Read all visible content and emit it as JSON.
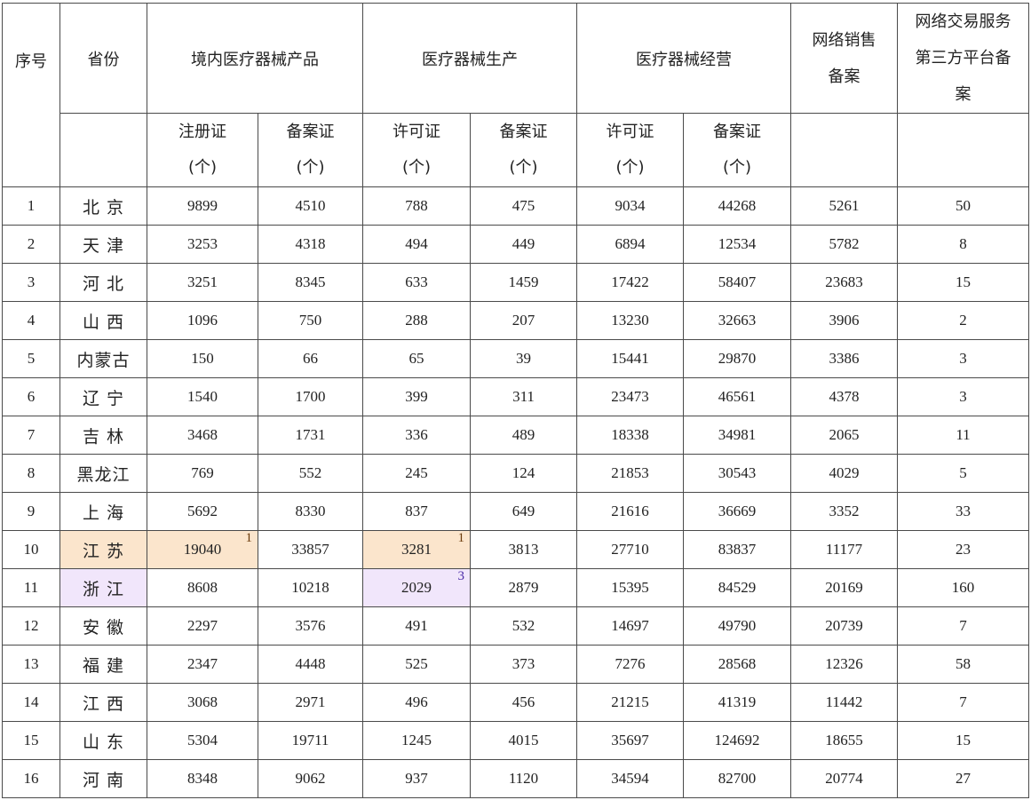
{
  "header": {
    "seq": "序号",
    "province": "省份",
    "domestic_products": "境内医疗器械产品",
    "production": "医疗器械生产",
    "operation": "医疗器械经营",
    "online_sales_line1": "网络销售",
    "online_sales_line2": "备案",
    "third_party_line1": "网络交易服务",
    "third_party_line2": "第三方平台备",
    "third_party_line3": "案"
  },
  "subheader": {
    "reg_cert": "注册证",
    "filing_cert": "备案证",
    "license": "许可证",
    "unit": "(个)"
  },
  "rows": [
    {
      "seq": "1",
      "province": "北 京",
      "values": [
        "9899",
        "4510",
        "788",
        "475",
        "9034",
        "44268",
        "5261",
        "50"
      ]
    },
    {
      "seq": "2",
      "province": "天 津",
      "values": [
        "3253",
        "4318",
        "494",
        "449",
        "6894",
        "12534",
        "5782",
        "8"
      ]
    },
    {
      "seq": "3",
      "province": "河 北",
      "values": [
        "3251",
        "8345",
        "633",
        "1459",
        "17422",
        "58407",
        "23683",
        "15"
      ]
    },
    {
      "seq": "4",
      "province": "山 西",
      "values": [
        "1096",
        "750",
        "288",
        "207",
        "13230",
        "32663",
        "3906",
        "2"
      ]
    },
    {
      "seq": "5",
      "province": "内蒙古",
      "values": [
        "150",
        "66",
        "65",
        "39",
        "15441",
        "29870",
        "3386",
        "3"
      ]
    },
    {
      "seq": "6",
      "province": "辽 宁",
      "values": [
        "1540",
        "1700",
        "399",
        "311",
        "23473",
        "46561",
        "4378",
        "3"
      ]
    },
    {
      "seq": "7",
      "province": "吉 林",
      "values": [
        "3468",
        "1731",
        "336",
        "489",
        "18338",
        "34981",
        "2065",
        "11"
      ]
    },
    {
      "seq": "8",
      "province": "黑龙江",
      "values": [
        "769",
        "552",
        "245",
        "124",
        "21853",
        "30543",
        "4029",
        "5"
      ]
    },
    {
      "seq": "9",
      "province": "上 海",
      "values": [
        "5692",
        "8330",
        "837",
        "649",
        "21616",
        "36669",
        "3352",
        "33"
      ]
    },
    {
      "seq": "10",
      "province": "江 苏",
      "values": [
        "19040",
        "33857",
        "3281",
        "3813",
        "27710",
        "83837",
        "11177",
        "23"
      ]
    },
    {
      "seq": "11",
      "province": "浙 江",
      "values": [
        "8608",
        "10218",
        "2029",
        "2879",
        "15395",
        "84529",
        "20169",
        "160"
      ]
    },
    {
      "seq": "12",
      "province": "安 徽",
      "values": [
        "2297",
        "3576",
        "491",
        "532",
        "14697",
        "49790",
        "20739",
        "7"
      ]
    },
    {
      "seq": "13",
      "province": "福 建",
      "values": [
        "2347",
        "4448",
        "525",
        "373",
        "7276",
        "28568",
        "12326",
        "58"
      ]
    },
    {
      "seq": "14",
      "province": "江 西",
      "values": [
        "3068",
        "2971",
        "496",
        "456",
        "21215",
        "41319",
        "11442",
        "7"
      ]
    },
    {
      "seq": "15",
      "province": "山 东",
      "values": [
        "5304",
        "19711",
        "1245",
        "4015",
        "35697",
        "124692",
        "18655",
        "15"
      ]
    },
    {
      "seq": "16",
      "province": "河 南",
      "values": [
        "8348",
        "9062",
        "937",
        "1120",
        "34594",
        "82700",
        "20774",
        "27"
      ]
    }
  ],
  "highlights": {
    "jiangsu": {
      "province_color": "#fbe5cc",
      "reg_rank": "1",
      "license_rank": "1"
    },
    "zhejiang": {
      "province_color": "#f1e6fb",
      "license_rank": "3"
    }
  }
}
